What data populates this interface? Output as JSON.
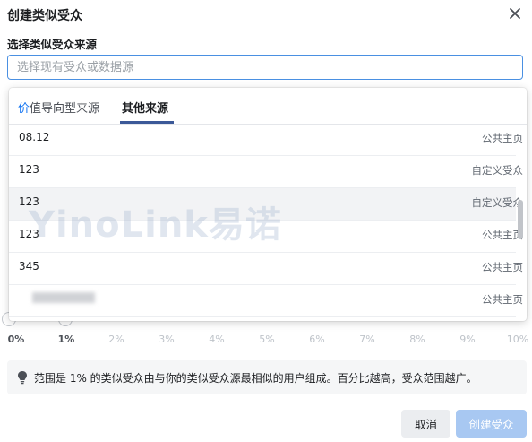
{
  "dialog": {
    "title": "创建类似受众",
    "section_label": "选择类似受众来源",
    "search_placeholder": "选择现有受众或数据源"
  },
  "dropdown": {
    "tabs": [
      {
        "label_prefix": "价",
        "label_rest": "值导向型来源",
        "active": false
      },
      {
        "label": "其他来源",
        "active": true
      }
    ],
    "rows": [
      {
        "name": "08.12",
        "type": "公共主页"
      },
      {
        "name": "123",
        "type": "自定义受众"
      },
      {
        "name": "123",
        "type": "自定义受众",
        "hovered": true
      },
      {
        "name": "123",
        "type": "公共主页"
      },
      {
        "name": "345",
        "type": "公共主页"
      },
      {
        "name": "",
        "type": "公共主页",
        "redacted": true
      }
    ]
  },
  "slider": {
    "ticks": [
      "0%",
      "1%",
      "2%",
      "3%",
      "4%",
      "5%",
      "6%",
      "7%",
      "8%",
      "9%",
      "10%"
    ],
    "range": [
      0,
      1
    ]
  },
  "info": {
    "icon": "lightbulb-icon",
    "text": "范围是 1% 的类似受众由与你的类似受众源最相似的用户组成。百分比越高，受众范围越广。"
  },
  "buttons": {
    "cancel": "取消",
    "create": "创建受众"
  },
  "watermark": "YinoLink易诺",
  "colors": {
    "accent": "#4a90e2",
    "tab_underline": "#3b5998",
    "create_disabled": "#a8c8f2"
  }
}
